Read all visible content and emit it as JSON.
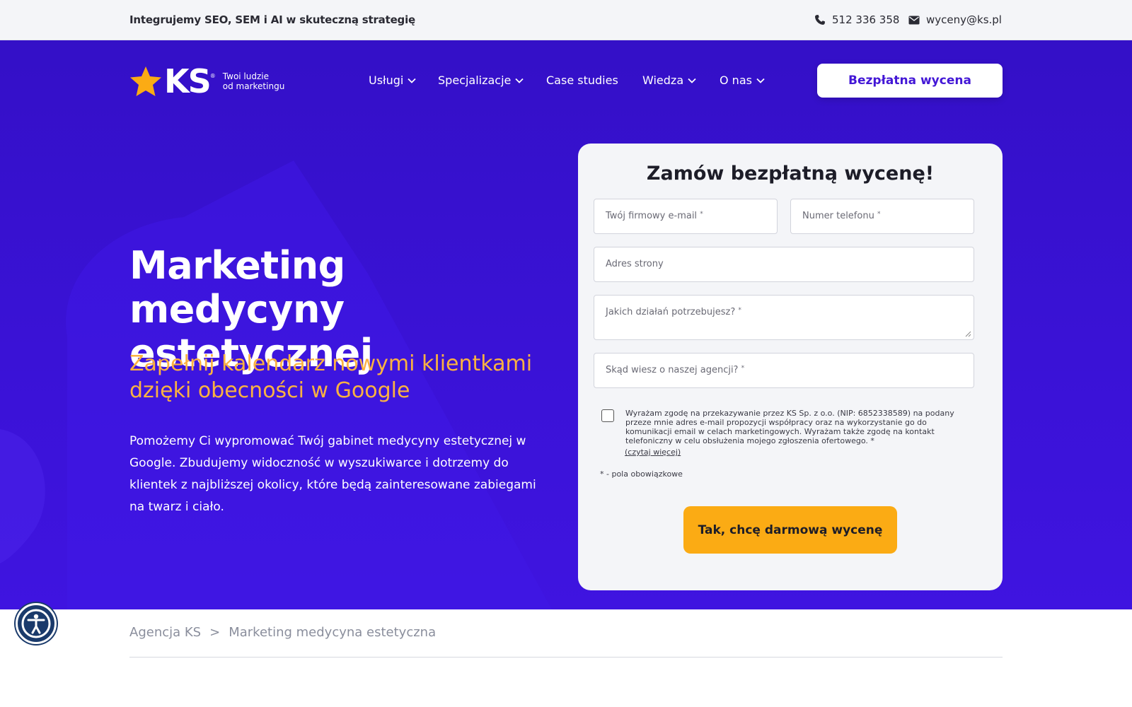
{
  "topbar": {
    "tagline": "Integrujemy SEO, SEM i AI w skuteczną strategię",
    "phone": "512 336 358",
    "email": "wyceny@ks.pl",
    "phone_icon": "phone-icon",
    "mail_icon": "envelope-icon"
  },
  "header": {
    "logo_text": "KS",
    "logo_reg": "®",
    "logo_slogan_line1": "Twoi ludzie",
    "logo_slogan_line2": "od marketingu",
    "nav": [
      {
        "label": "Usługi",
        "dropdown": true
      },
      {
        "label": "Specjalizacje",
        "dropdown": true
      },
      {
        "label": "Case studies",
        "dropdown": false
      },
      {
        "label": "Wiedza",
        "dropdown": true
      },
      {
        "label": "O nas",
        "dropdown": true
      }
    ],
    "cta_label": "Bezpłatna wycena"
  },
  "hero": {
    "title": "Marketing medycyny estetycznej",
    "subtitle": "Zapełnij kalendarz nowymi klientkami dzięki obecności w Google",
    "description": "Pomożemy Ci wypromować Twój gabinet medycyny estetycznej w Google. Zbudujemy widoczność w wyszukiwarce i dotrzemy do klientek z najbliższej okolicy, które będą zainteresowane zabiegami na twarz i ciało."
  },
  "form": {
    "title": "Zamów bezpłatną wycenę!",
    "email_placeholder": "Twój firmowy e-mail",
    "phone_placeholder": "Numer telefonu",
    "website_placeholder": "Adres strony",
    "needs_placeholder": "Jakich działań potrzebujesz?",
    "source_placeholder": "Skąd wiesz o naszej agencji?",
    "required_mark": "*",
    "consent_text": "Wyrażam zgodę na przekazywanie przez KS Sp. z o.o. (NIP: 6852338589) na podany przeze mnie adres e-mail propozycji współpracy oraz na wykorzystanie go do komunikacji email w celach marketingowych. Wyrażam także zgodę na kontakt telefoniczny w celu obsłużenia mojego zgłoszenia ofertowego. *",
    "consent_more": "(czytaj więcej)",
    "required_note": "* - pola obowiązkowe",
    "submit_label": "Tak, chcę darmową wycenę"
  },
  "breadcrumb": {
    "home": "Agencja KS",
    "separator": ">",
    "current": "Marketing medycyna estetyczna"
  },
  "accessibility": {
    "icon": "accessibility-icon"
  },
  "colors": {
    "brand_purple": "#3a12d6",
    "accent_orange": "#fbb241",
    "cta_yellow": "#fbab14",
    "star": "#fbab14"
  }
}
